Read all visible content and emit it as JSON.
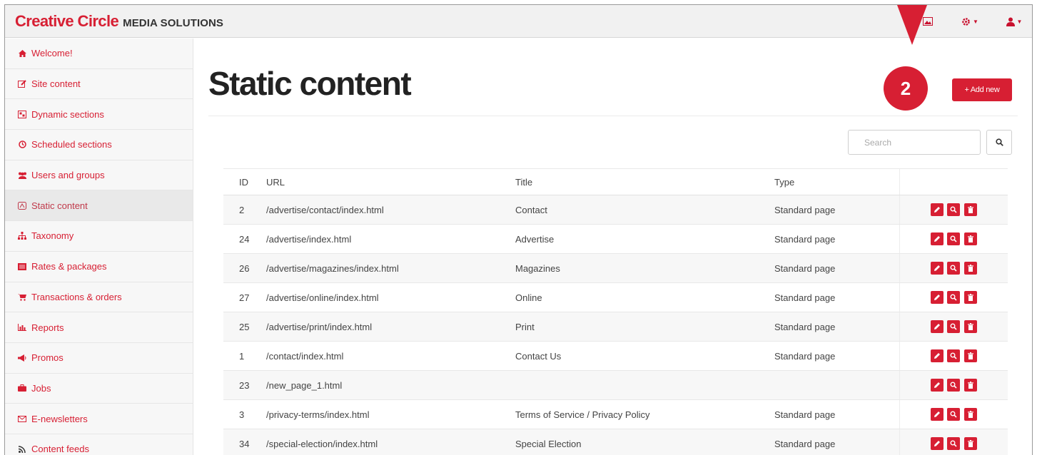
{
  "brand": {
    "main": "Creative Circle",
    "sub": "MEDIA SOLUTIONS"
  },
  "colors": {
    "accent": "#d71f33",
    "sidebar_bg": "#f7f7f7",
    "topbar_bg": "#f1f1f1"
  },
  "topbar": {
    "icons": [
      "image-icon",
      "gear-icon",
      "user-icon"
    ]
  },
  "callout": {
    "number": "2"
  },
  "sidebar": {
    "items": [
      {
        "label": "Welcome!",
        "icon": "home-icon"
      },
      {
        "label": "Site content",
        "icon": "edit-icon"
      },
      {
        "label": "Dynamic sections",
        "icon": "sections-icon"
      },
      {
        "label": "Scheduled sections",
        "icon": "clock-icon"
      },
      {
        "label": "Users and groups",
        "icon": "users-icon"
      },
      {
        "label": "Static content",
        "icon": "static-icon",
        "active": true
      },
      {
        "label": "Taxonomy",
        "icon": "sitemap-icon"
      },
      {
        "label": "Rates & packages",
        "icon": "list-icon"
      },
      {
        "label": "Transactions & orders",
        "icon": "cart-icon"
      },
      {
        "label": "Reports",
        "icon": "chart-icon"
      },
      {
        "label": "Promos",
        "icon": "megaphone-icon"
      },
      {
        "label": "Jobs",
        "icon": "briefcase-icon"
      },
      {
        "label": "E-newsletters",
        "icon": "envelope-icon"
      },
      {
        "label": "Content feeds",
        "icon": "rss-icon"
      }
    ]
  },
  "main": {
    "title": "Static content",
    "add_button": "+ Add new",
    "search": {
      "placeholder": "Search"
    }
  },
  "table": {
    "columns": [
      "ID",
      "URL",
      "Title",
      "Type",
      ""
    ],
    "rows": [
      {
        "id": "2",
        "url": "/advertise/contact/index.html",
        "title": "Contact",
        "type": "Standard page"
      },
      {
        "id": "24",
        "url": "/advertise/index.html",
        "title": "Advertise",
        "type": "Standard page"
      },
      {
        "id": "26",
        "url": "/advertise/magazines/index.html",
        "title": "Magazines",
        "type": "Standard page"
      },
      {
        "id": "27",
        "url": "/advertise/online/index.html",
        "title": "Online",
        "type": "Standard page"
      },
      {
        "id": "25",
        "url": "/advertise/print/index.html",
        "title": "Print",
        "type": "Standard page"
      },
      {
        "id": "1",
        "url": "/contact/index.html",
        "title": "Contact Us",
        "type": "Standard page"
      },
      {
        "id": "23",
        "url": "/new_page_1.html",
        "title": "",
        "type": ""
      },
      {
        "id": "3",
        "url": "/privacy-terms/index.html",
        "title": "Terms of Service / Privacy Policy",
        "type": "Standard page"
      },
      {
        "id": "34",
        "url": "/special-election/index.html",
        "title": "Special Election",
        "type": "Standard page"
      }
    ],
    "row_actions": [
      "pencil-icon",
      "search-icon",
      "trash-icon"
    ]
  }
}
